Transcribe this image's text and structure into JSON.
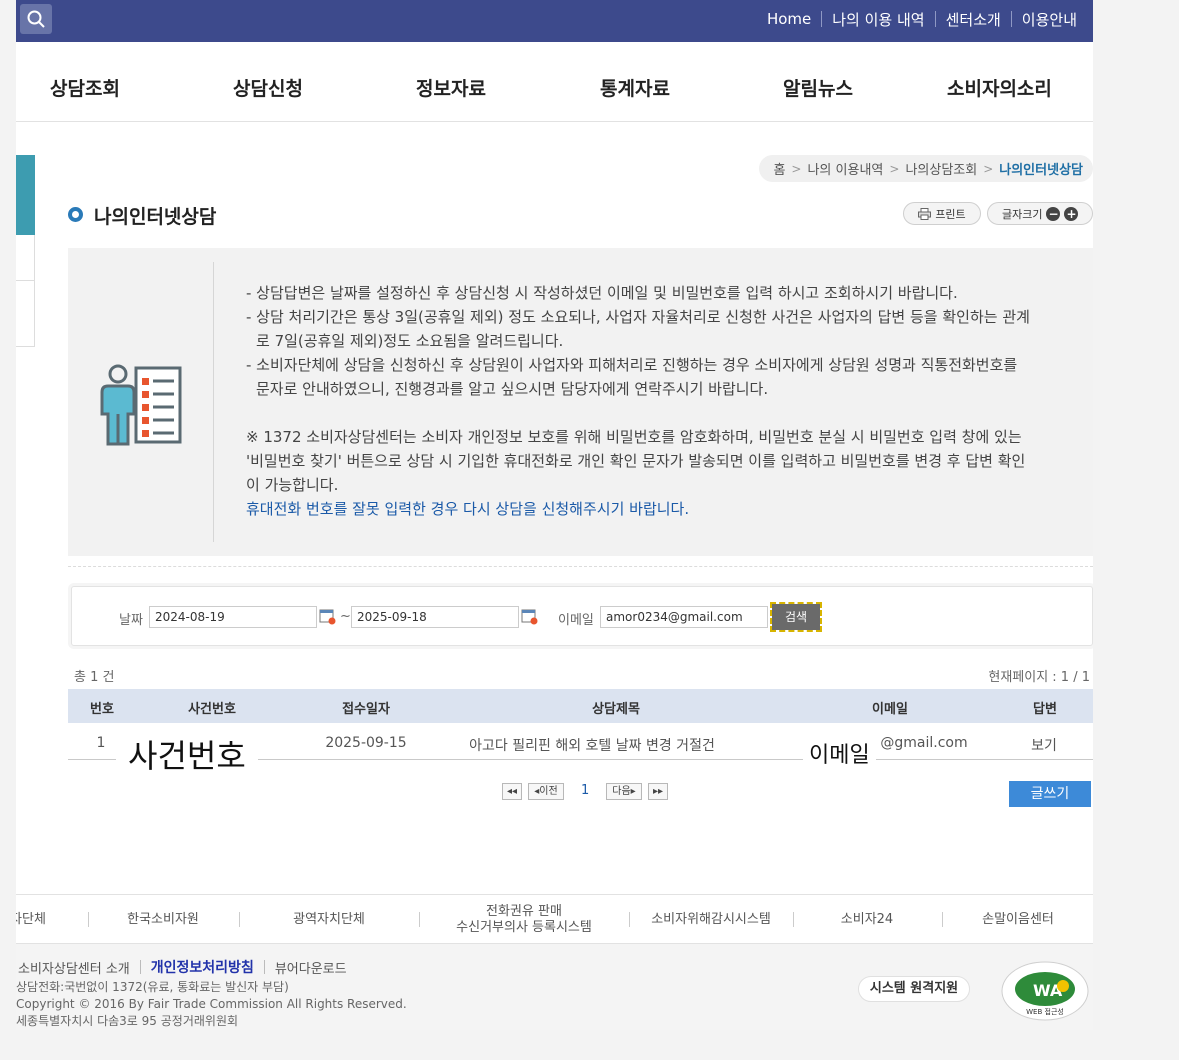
{
  "topbar": {
    "links": [
      "Home",
      "나의 이용 내역",
      "센터소개",
      "이용안내"
    ]
  },
  "gnb": {
    "items": [
      "상담조회",
      "상담신청",
      "정보자료",
      "통계자료",
      "알림뉴스",
      "소비자의소리"
    ]
  },
  "breadcrumb": {
    "home": "홈",
    "level1": "나의 이용내역",
    "level2": "나의상담조회",
    "current": "나의인터넷상담"
  },
  "page": {
    "title": "나의인터넷상담",
    "print_label": "프린트",
    "font_size_label": "글자크기",
    "font_minus": "−",
    "font_plus": "+"
  },
  "info": {
    "line1": "- 상담답변은 날짜를 설정하신 후 상담신청 시 작성하셨던 이메일 및 비밀번호를 입력 하시고 조회하시기 바랍니다.",
    "line2a": "- 상담 처리기간은 통상 3일(공휴일 제외) 정도 소요되나, 사업자 자율처리로 신청한 사건은 사업자의 답변 등을 확인하는 관계",
    "line2b": "로 7일(공휴일 제외)정도 소요됨을 알려드립니다.",
    "line3a": "- 소비자단체에 상담을 신청하신 후 상담원이 사업자와 피해처리로 진행하는 경우 소비자에게 상담원 성명과 직통전화번호를",
    "line3b": "문자로 안내하였으니, 진행경과를 알고 싶으시면 담당자에게 연락주시기 바랍니다.",
    "note1": "※ 1372 소비자상담센터는 소비자 개인정보 보호를 위해 비밀번호를 암호화하며, 비밀번호 분실 시 비밀번호 입력 창에 있는",
    "note2": "'비밀번호 찾기' 버튼으로 상담 시 기입한 휴대전화로 개인 확인 문자가 발송되면 이를 입력하고 비밀번호를 변경 후 답변 확인",
    "note3": "이 가능합니다.",
    "note_blue": "휴대전화 번호를 잘못 입력한 경우 다시 상담을 신청해주시기 바랍니다."
  },
  "search": {
    "date_label": "날짜",
    "date_from": "2024-08-19",
    "tilde": "~",
    "date_to": "2025-09-18",
    "email_label": "이메일",
    "email_value": "amor0234@gmail.com",
    "button": "검색"
  },
  "results": {
    "count": "총 1 건",
    "page_info": "현재페이지 : 1 / 1",
    "columns": [
      "번호",
      "사건번호",
      "접수일자",
      "상담제목",
      "이메일",
      "답변"
    ],
    "rows": [
      {
        "no": "1",
        "case_no": "사건번호",
        "date": "2025-09-15",
        "subject": "아고다 필리핀 해외 호텔 날짜 변경 거절건",
        "email_overlay": "이메일",
        "email": "@gmail.com",
        "answer": "보기"
      }
    ]
  },
  "pagination": {
    "first": "◂◂",
    "prev": "◂이전",
    "current": "1",
    "next": "다음▸",
    "last": "▸▸"
  },
  "write_button": "글쓰기",
  "footer_links": [
    "자단체",
    "한국소비자원",
    "광역자치단체",
    "전화권유 판매",
    "수신거부의사 등록시스템",
    "소비자위해감시시스템",
    "소비자24",
    "손말이음센터"
  ],
  "footer": {
    "about": "소비자상담센터 소개",
    "privacy": "개인정보처리방침",
    "viewer": "뷰어다운로드",
    "phone": "상담전화:국번없이 1372(유료, 통화료는 발신자 부담)",
    "copyright": "Copyright © 2016 By Fair Trade Commission All Rights Reserved.",
    "address": "세종특별자치시 다솜3로 95 공정거래위원회",
    "remote": "시스템 원격지원",
    "wa_text": "WA",
    "wa_sub": "WEB 접근성"
  },
  "colors": {
    "topbar": "#3d4a8c",
    "accent_teal": "#3d9cb0",
    "table_header": "#dbe3f0",
    "write_button": "#3d8ad8",
    "link_blue": "#1b5aa8"
  }
}
